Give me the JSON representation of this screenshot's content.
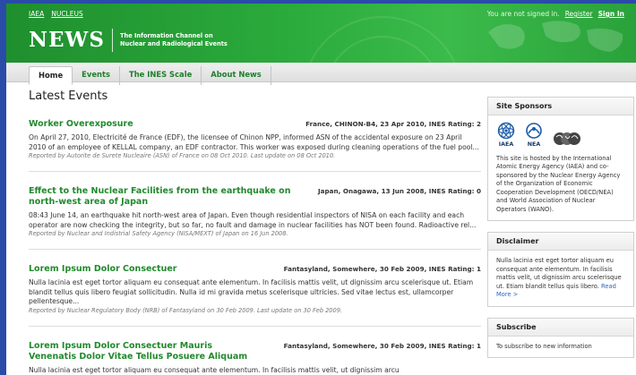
{
  "header": {
    "toplinks": [
      "IAEA",
      "NUCLEUS"
    ],
    "signin_text": "You are not signed in.",
    "register_label": "Register",
    "signin_label": "Sign In",
    "logo_word": "NEWS",
    "logo_tagline_1": "The Information Channel on",
    "logo_tagline_2": "Nuclear and Radiological Events"
  },
  "nav": {
    "tabs": [
      {
        "label": "Home",
        "active": true
      },
      {
        "label": "Events"
      },
      {
        "label": "The INES Scale"
      },
      {
        "label": "About News"
      }
    ]
  },
  "main": {
    "title": "Latest Events",
    "events": [
      {
        "title": "Worker Overexposure",
        "meta": "France, CHINON-B4, 23 Apr 2010, INES Rating: 2",
        "body": "On April 27, 2010, Electricité de France (EDF), the licensee of Chinon NPP, informed ASN of the accidental exposure on 23 April 2010 of an employee of KELLAL company, an EDF contractor. This worker was exposed during cleaning operations of the fuel pool...",
        "report": "Reported by Autorite de Surete Nucleaire (ASN) of France on 08 Oct 2010. Last update on 08 Oct 2010."
      },
      {
        "title": "Effect to the Nuclear Facilities from the earthquake on north-west area of Japan",
        "meta": "Japan, Onagawa, 13 Jun 2008, INES Rating: 0",
        "body": "08:43 June 14, an earthquake hit north-west area of Japan. Even though residential inspectors of NISA on each facility and each operator are now checking the integrity, but so far, no fault and damage in nuclear facilities has NOT been found. Radioactive rel...",
        "report": "Reported by Nuclear and Indistrial Safety Agency (NISA/MEXT) of Japan on 16 Jun 2008."
      },
      {
        "title": "Lorem Ipsum Dolor Consectuer",
        "meta": "Fantasyland, Somewhere, 30 Feb 2009, INES Rating: 1",
        "body": "Nulla lacinia est eget tortor aliquam eu consequat ante elementum. In facilisis mattis velit, ut dignissim arcu scelerisque ut. Etiam blandit tellus quis libero feugiat sollicitudin. Nulla id mi gravida metus scelerisque ultricies. Sed vitae lectus est, ullamcorper pellentesque...",
        "report": "Reported by Nuclear Regulatory Body (NRB) of Fantasyland on 30 Feb 2009. Last update on 30 Feb 2009."
      },
      {
        "title": "Lorem Ipsum Dolor Consectuer Mauris Venenatis Dolor Vitae Tellus Posuere Aliquam",
        "meta": "Fantasyland, Somewhere, 30 Feb 2009, INES Rating: 1",
        "body": "Nulla lacinia est eget tortor aliquam eu consequat ante elementum. In facilisis mattis velit, ut dignissim arcu",
        "report": ""
      }
    ]
  },
  "sidebar": {
    "sponsors_title": "Site Sponsors",
    "sponsor_labels": [
      "IAEA",
      "NEA"
    ],
    "sponsors_text": "This site is hosted by the International Atomic Energy Agency (IAEA) and co-sponsored by the Nuclear Energy Agency of the Organization of Economic Cooperation Development (OECD/NEA) and World Association of Nuclear Operators (WANO).",
    "disclaimer_title": "Disclaimer",
    "disclaimer_text": "Nulla lacinia est eget tortor aliquam eu consequat ante elementum. In facilisis mattis velit, ut dignissim arcu scelerisque ut. Etiam blandit tellus quis libero.",
    "read_more": "Read More >",
    "subscribe_title": "Subscribe",
    "subscribe_text": "To subscribe to new information"
  },
  "colors": {
    "header_green": "#25a035",
    "link_green": "#218a2d",
    "outer_blue": "#2a4ba8"
  }
}
